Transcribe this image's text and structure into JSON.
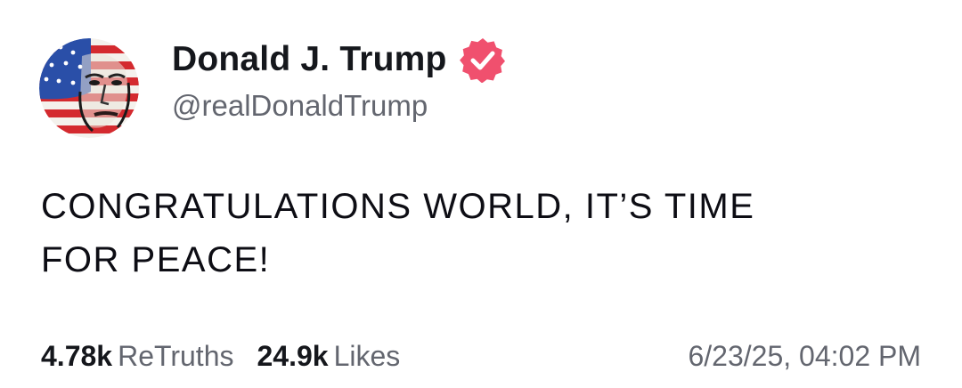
{
  "author": {
    "display_name": "Donald J. Trump",
    "handle": "@realDonaldTrump",
    "verified": true,
    "avatar_icon": "flag-portrait-avatar",
    "verified_icon": "verified-badge-icon",
    "verified_color": "#f0506e"
  },
  "post": {
    "text": "CONGRATULATIONS WORLD, IT’S TIME\nFOR PEACE!"
  },
  "stats": {
    "retruths_count": "4.78k",
    "retruths_label": "ReTruths",
    "likes_count": "24.9k",
    "likes_label": "Likes"
  },
  "timestamp": "6/23/25, 04:02 PM"
}
